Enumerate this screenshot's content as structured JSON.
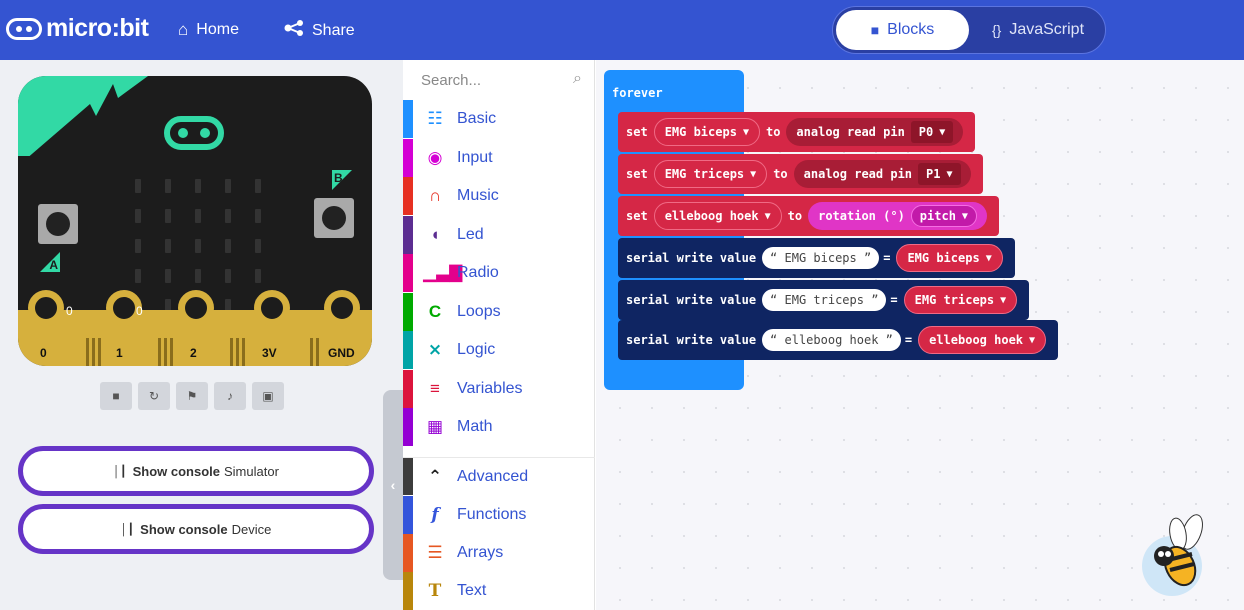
{
  "header": {
    "logo_text": "micro:bit",
    "home_label": "Home",
    "share_label": "Share",
    "tabs": {
      "blocks": "Blocks",
      "javascript": "JavaScript"
    },
    "active_tab": "blocks",
    "color": "#3454d1"
  },
  "simulator": {
    "button_a": "A",
    "button_b": "B",
    "pins": [
      "0",
      "1",
      "2",
      "3V",
      "GND"
    ],
    "pin_values": [
      "0",
      "0"
    ],
    "controls": [
      "stop-icon",
      "restart-icon",
      "slow-mo-icon",
      "mute-icon",
      "screenshot-icon"
    ],
    "console_simulator": {
      "bold": "Show console",
      "label": "Simulator"
    },
    "console_device": {
      "bold": "Show console",
      "label": "Device"
    }
  },
  "toolbox": {
    "search_placeholder": "Search...",
    "categories": [
      {
        "label": "Basic",
        "color": "#1e90ff",
        "icon": "grid-icon"
      },
      {
        "label": "Input",
        "color": "#d400d4",
        "icon": "target-icon"
      },
      {
        "label": "Music",
        "color": "#e63022",
        "icon": "headphones-icon"
      },
      {
        "label": "Led",
        "color": "#5c2d91",
        "icon": "toggle-icon"
      },
      {
        "label": "Radio",
        "color": "#e3008c",
        "icon": "signal-icon"
      },
      {
        "label": "Loops",
        "color": "#00aa00",
        "icon": "loop-icon"
      },
      {
        "label": "Logic",
        "color": "#00a4a6",
        "icon": "shuffle-icon"
      },
      {
        "label": "Variables",
        "color": "#dc143c",
        "icon": "list-icon"
      },
      {
        "label": "Math",
        "color": "#9400d3",
        "icon": "calculator-icon"
      },
      {
        "label": "Advanced",
        "color": "#3c3c3c",
        "icon": "chevron-up-icon"
      },
      {
        "label": "Functions",
        "color": "#3455db",
        "icon": "function-icon"
      },
      {
        "label": "Arrays",
        "color": "#e65722",
        "icon": "ordered-list-icon"
      },
      {
        "label": "Text",
        "color": "#b8860b",
        "icon": "text-icon"
      }
    ]
  },
  "workspace": {
    "forever_label": "forever",
    "set_rows": [
      {
        "kw": "set",
        "var": "EMG biceps",
        "to": "to",
        "expr": "analog read pin",
        "arg": "P0"
      },
      {
        "kw": "set",
        "var": "EMG triceps",
        "to": "to",
        "expr": "analog read pin",
        "arg": "P1"
      },
      {
        "kw": "set",
        "var": "elleboog hoek",
        "to": "to",
        "expr": "rotation (°)",
        "arg": "pitch"
      }
    ],
    "serial_rows": [
      {
        "label": "serial write value",
        "name": "EMG biceps",
        "eq": "=",
        "value": "EMG biceps"
      },
      {
        "label": "serial write value",
        "name": "EMG triceps",
        "eq": "=",
        "value": "EMG triceps"
      },
      {
        "label": "serial write value",
        "name": "elleboog hoek",
        "eq": "=",
        "value": "elleboog hoek"
      }
    ]
  }
}
